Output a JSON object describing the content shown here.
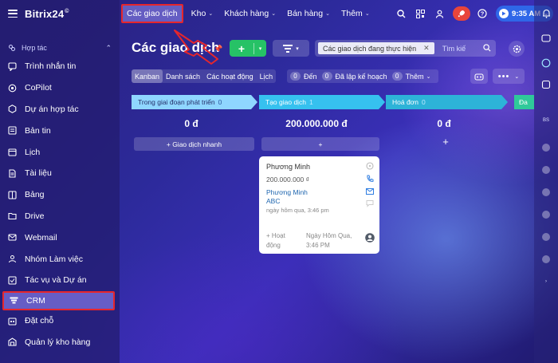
{
  "app": {
    "logo": "Bitrix24",
    "logo_mark": "©"
  },
  "sidebar": {
    "section": "Hợp tác",
    "items": [
      {
        "label": "Trình nhắn tin"
      },
      {
        "label": "CoPilot"
      },
      {
        "label": "Dự án hợp tác"
      },
      {
        "label": "Bản tin"
      },
      {
        "label": "Lịch"
      },
      {
        "label": "Tài liệu"
      },
      {
        "label": "Bảng"
      },
      {
        "label": "Drive"
      },
      {
        "label": "Webmail"
      },
      {
        "label": "Nhóm Làm việc"
      },
      {
        "label": "Tác vụ và Dự án"
      },
      {
        "label": "CRM"
      },
      {
        "label": "Đặt chỗ"
      },
      {
        "label": "Quản lý kho hàng"
      }
    ]
  },
  "topnav": {
    "items": [
      {
        "label": "Các giao dịch"
      },
      {
        "label": "Kho"
      },
      {
        "label": "Khách hàng"
      },
      {
        "label": "Bán hàng"
      },
      {
        "label": "Thêm"
      }
    ],
    "clock": "9:35 AM"
  },
  "page": {
    "title": "Các giao dịch",
    "add_label": "+",
    "filter_chip": "Các giao dịch đang thực hiện",
    "search_placeholder": "Tìm kiế"
  },
  "view_tabs": [
    "Kanban",
    "Danh sách",
    "Các hoạt động",
    "Lịch"
  ],
  "counters": [
    {
      "num": "0",
      "label": "Đến"
    },
    {
      "num": "0",
      "label": "Đã lập kế hoạch"
    },
    {
      "num": "0",
      "label": "Thêm"
    }
  ],
  "kanban": {
    "columns": [
      {
        "name": "Trong giai đoạn phát triển",
        "count": "0",
        "sum": "0 đ",
        "quick_add": "+ Giao dịch nhanh",
        "color": "#8fd6ff"
      },
      {
        "name": "Tạo giao dịch",
        "count": "1",
        "sum": "200.000.000 đ",
        "quick_add": "+",
        "color": "#36c1ef"
      },
      {
        "name": "Hoá đơn",
        "count": "0",
        "sum": "0 đ",
        "quick_add": "+",
        "color": "#2db3d8"
      },
      {
        "name": "Đa",
        "count": "",
        "sum": "",
        "quick_add": "",
        "color": "#2fc99a"
      }
    ],
    "card": {
      "title": "Phương Minh",
      "amount": "200.000.000 ₫",
      "contact_name": "Phương Minh",
      "company": "ABC",
      "time": "ngày hôm qua, 3:46 pm",
      "activity_line1": "+ Hoạt",
      "activity_line2": "động",
      "date_line1": "Ngày Hôm Qua,",
      "date_line2": "3:46 PM"
    }
  },
  "colors": {
    "highlight": "#e6262c",
    "add_button": "#26c266",
    "clock": "#2f67e8"
  }
}
